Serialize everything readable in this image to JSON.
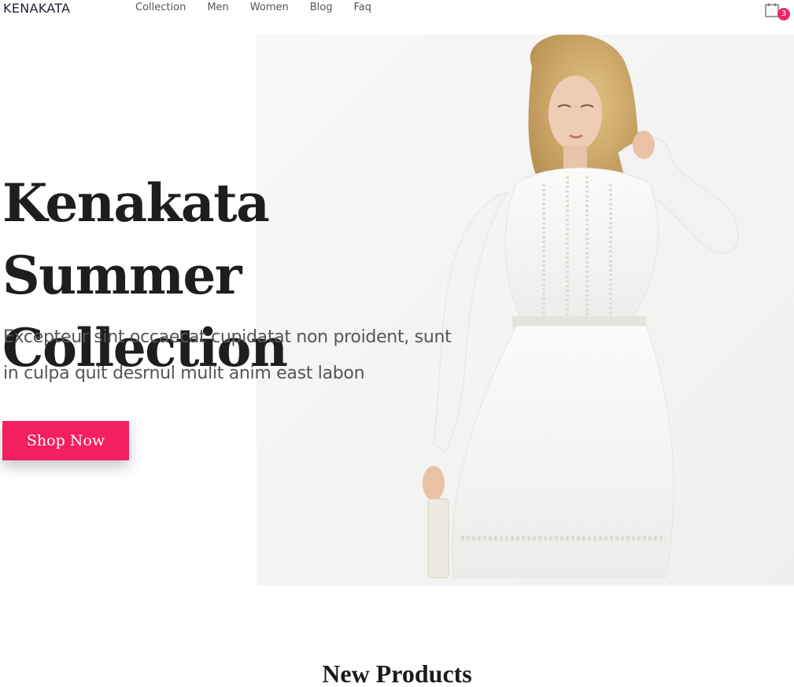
{
  "nav": {
    "brand": "KENAKATA",
    "links": [
      "Collection",
      "Men",
      "Women",
      "Blog",
      "Faq"
    ],
    "cart_count": "3",
    "cart_icon": "shopping-bag-icon"
  },
  "hero": {
    "title": "Kenakata Summer Collection",
    "text": "Excepteur sint occaecat cupidatat non proident, sunt in culpa quit desrnul mulit anim east labon",
    "button_label": "Shop Now",
    "image_alt": "Model wearing a white lace summer dress"
  },
  "section": {
    "title": "New Products"
  },
  "colors": {
    "accent": "#f41f63",
    "badge": "#f0266a",
    "text": "#1e1e1e",
    "muted": "#555555"
  }
}
